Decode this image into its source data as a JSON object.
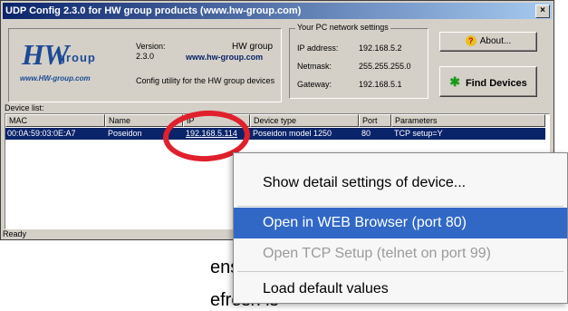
{
  "window": {
    "title": "UDP Config 2.3.0 for HW group products (www.hw-group.com)",
    "close_glyph": "×"
  },
  "info": {
    "logo_brand": "HW",
    "logo_group": "group",
    "logo_url": "www.HW-group.com",
    "version_label": "Version:",
    "version_value": "2.3.0",
    "company": "HW group",
    "company_url": "www.hw-group.com",
    "description": "Config utility for the HW group devices"
  },
  "network": {
    "legend": "Your PC network settings",
    "ip_label": "IP address:",
    "ip_value": "192.168.5.2",
    "mask_label": "Netmask:",
    "mask_value": "255.255.255.0",
    "gw_label": "Gateway:",
    "gw_value": "192.168.5.1"
  },
  "buttons": {
    "about": "About...",
    "find": "Find Devices"
  },
  "device_list": {
    "label": "Device list:",
    "columns": [
      "MAC",
      "Name",
      "IP",
      "Device type",
      "Port",
      "Parameters"
    ],
    "rows": [
      {
        "mac": "00:0A:59:03:0E:A7",
        "name": "Poseidon",
        "ip": "192.168.5.114",
        "type": "Poseidon model 1250",
        "port": "80",
        "params": "TCP setup=Y"
      }
    ]
  },
  "status": "Ready",
  "context_menu": {
    "items": [
      {
        "label": "Show detail settings of device..."
      },
      {
        "label": "Open in WEB Browser (port 80)"
      },
      {
        "label": "Open TCP Setup (telnet on port 99)"
      },
      {
        "label": "Load default values"
      }
    ]
  },
  "background_text": {
    "line1": "ensor.",
    "line2": "efresh is"
  },
  "colors": {
    "accent_blue": "#0a246a",
    "highlight": "#3168c6",
    "annotation_red": "#e0202c"
  }
}
